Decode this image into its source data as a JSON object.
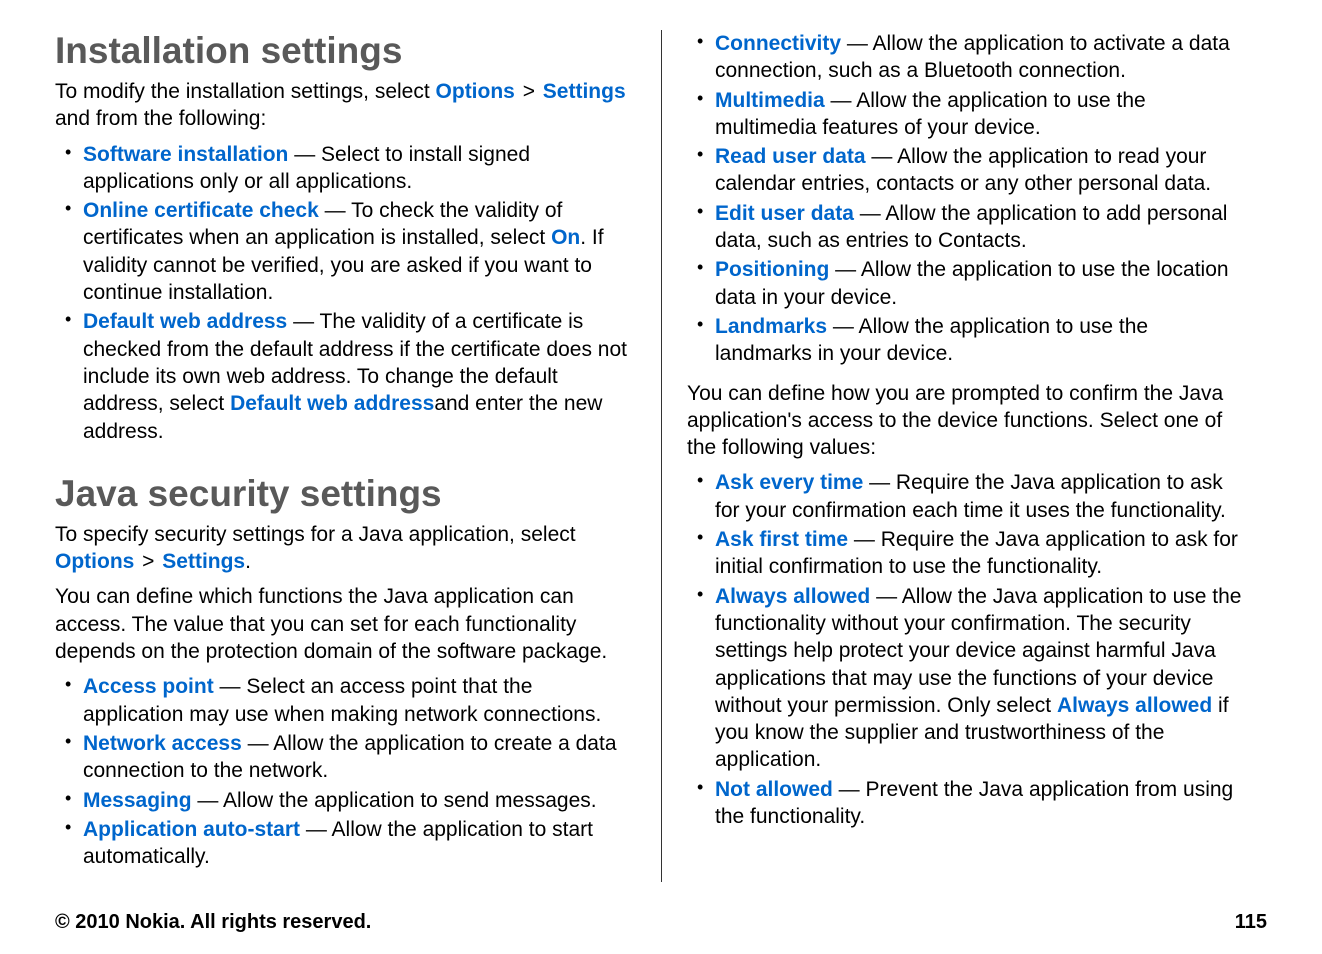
{
  "section1": {
    "heading": "Installation settings",
    "intro_1": "To modify the installation settings, select ",
    "intro_options": "Options",
    "intro_gt": " > ",
    "intro_settings": "Settings",
    "intro_2": " and from the following:",
    "items": [
      {
        "label": "Software installation",
        "desc": " — Select to install signed applications only or all applications."
      },
      {
        "label": "Online certificate check",
        "desc_1": " — To check the validity of certificates when an application is installed, select ",
        "on": "On",
        "desc_2": ". If validity cannot be verified, you are asked if you want to continue installation."
      },
      {
        "label": "Default web address",
        "desc_1": " — The validity of a certificate is checked from the default address if the certificate does not include its own web address. To change the default address, select ",
        "inline": "Default web address",
        "desc_2": "and enter the new address."
      }
    ]
  },
  "section2": {
    "heading": "Java security settings",
    "intro_1": "To specify security settings for a Java application, select ",
    "intro_options": "Options",
    "intro_gt": " > ",
    "intro_settings": "Settings",
    "intro_2": ".",
    "para2": "You can define which functions the Java application can access. The value that you can set for each functionality depends on the protection domain of the software package.",
    "items_a": [
      {
        "label": "Access point",
        "desc": " — Select an access point that the application may use when making network connections."
      },
      {
        "label": "Network access",
        "desc": " — Allow the application to create a data connection to the network."
      },
      {
        "label": "Messaging",
        "desc": " — Allow the application to send messages."
      },
      {
        "label": "Application auto-start",
        "desc": " — Allow the application to start automatically."
      }
    ],
    "items_b": [
      {
        "label": "Connectivity",
        "desc": " — Allow the application to activate a data connection, such as a Bluetooth connection."
      },
      {
        "label": "Multimedia",
        "desc": " — Allow the application to use the multimedia features of your device."
      },
      {
        "label": "Read user data",
        "desc": " — Allow the application to read your calendar entries, contacts or any other personal data."
      },
      {
        "label": "Edit user data",
        "desc": " — Allow the application to add personal data, such as entries to Contacts."
      },
      {
        "label": "Positioning",
        "desc": " — Allow the application to use the location data in your device."
      },
      {
        "label": "Landmarks",
        "desc": " — Allow the application to use the landmarks in your device."
      }
    ],
    "para3": "You can define how you are prompted to confirm the Java application's access to the device functions. Select one of the following values:",
    "items_c": [
      {
        "label": "Ask every time",
        "desc": " — Require the Java application to ask for your confirmation each time it uses the functionality."
      },
      {
        "label": "Ask first time",
        "desc": " — Require the Java application to ask for initial confirmation to use the functionality."
      },
      {
        "label": "Always allowed",
        "desc_1": " — Allow the Java application to use the functionality without your confirmation. The security settings help protect your device against harmful Java applications that may use the functions of your device without your permission. Only select ",
        "inline": "Always allowed",
        "desc_2": " if you know the supplier and trustworthiness of the application."
      },
      {
        "label": "Not allowed",
        "desc": " — Prevent the Java application from using the functionality."
      }
    ]
  },
  "footer": {
    "copyright": "© 2010 Nokia. All rights reserved.",
    "page": "115"
  }
}
